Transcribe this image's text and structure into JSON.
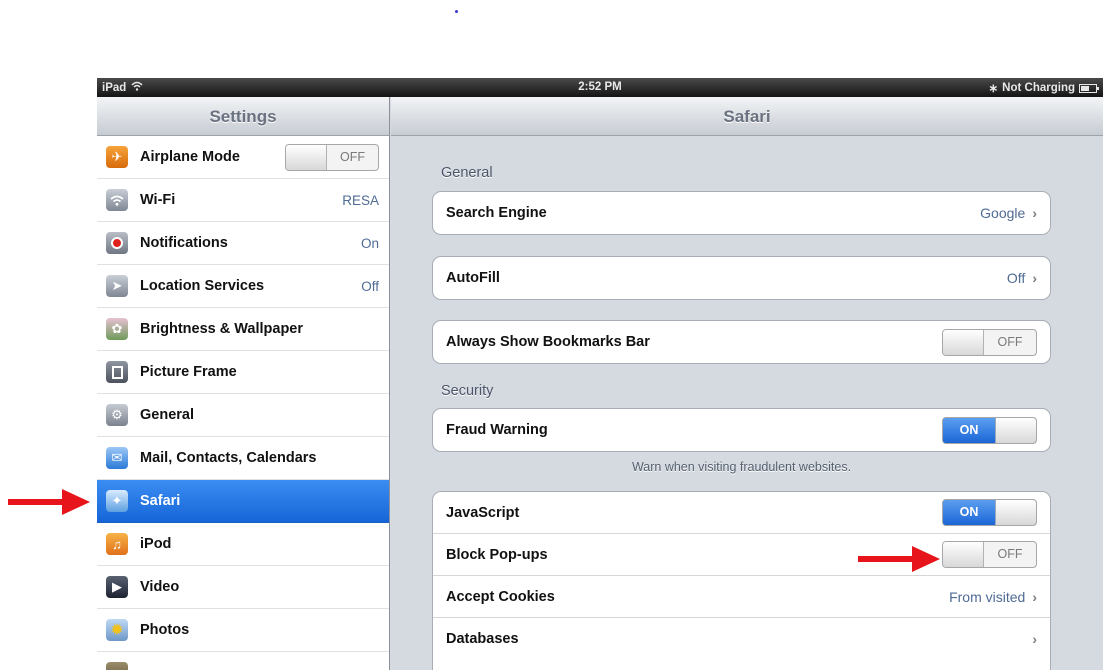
{
  "status_bar": {
    "device": "iPad",
    "time": "2:52 PM",
    "charging": "Not Charging"
  },
  "left_pane": {
    "title": "Settings",
    "items": [
      {
        "label": "Airplane Mode",
        "icon": "airplane-icon",
        "toggle": "OFF"
      },
      {
        "label": "Wi-Fi",
        "icon": "wifi-icon",
        "value": "RESA"
      },
      {
        "label": "Notifications",
        "icon": "notifications-icon",
        "value": "On"
      },
      {
        "label": "Location Services",
        "icon": "location-icon",
        "value": "Off"
      },
      {
        "label": "Brightness & Wallpaper",
        "icon": "brightness-icon"
      },
      {
        "label": "Picture Frame",
        "icon": "picture-frame-icon"
      },
      {
        "label": "General",
        "icon": "gear-icon"
      },
      {
        "label": "Mail, Contacts, Calendars",
        "icon": "mail-icon"
      },
      {
        "label": "Safari",
        "icon": "safari-icon",
        "selected": true
      },
      {
        "label": "iPod",
        "icon": "ipod-icon"
      },
      {
        "label": "Video",
        "icon": "video-icon"
      },
      {
        "label": "Photos",
        "icon": "photos-icon"
      }
    ]
  },
  "right_pane": {
    "title": "Safari",
    "sections": {
      "general": "General",
      "security": "Security"
    },
    "rows": {
      "search_engine": {
        "label": "Search Engine",
        "value": "Google"
      },
      "autofill": {
        "label": "AutoFill",
        "value": "Off"
      },
      "bookmarks_bar": {
        "label": "Always Show Bookmarks Bar",
        "toggle": "OFF"
      },
      "fraud_warning": {
        "label": "Fraud Warning",
        "toggle": "ON"
      },
      "javascript": {
        "label": "JavaScript",
        "toggle": "ON"
      },
      "block_popups": {
        "label": "Block Pop-ups",
        "toggle": "OFF"
      },
      "accept_cookies": {
        "label": "Accept Cookies",
        "value": "From visited"
      },
      "databases": {
        "label": "Databases"
      }
    },
    "fraud_footnote": "Warn when visiting fraudulent websites."
  },
  "colors": {
    "selected_row": "#1e6fe0",
    "toggle_on": "#2a71d9",
    "value_text": "#4f6b94",
    "annotation_arrow": "#e8141b"
  }
}
